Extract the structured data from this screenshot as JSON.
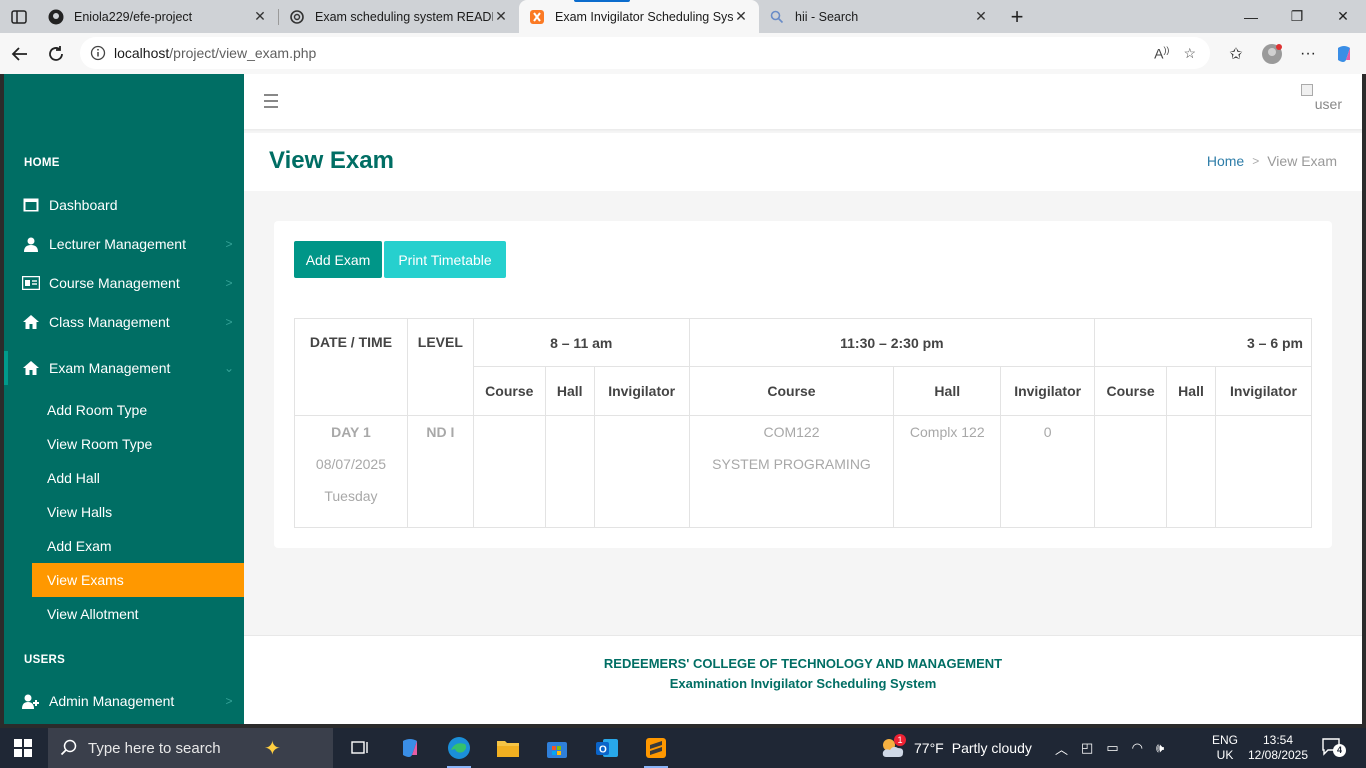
{
  "browser": {
    "tabs": [
      {
        "title": "Eniola229/efe-project",
        "icon": "github-icon"
      },
      {
        "title": "Exam scheduling system README",
        "icon": "chatgpt-icon"
      },
      {
        "title": "Exam Invigilator Scheduling Syste",
        "icon": "xampp-icon",
        "active": true
      },
      {
        "title": "hii - Search",
        "icon": "search-icon"
      }
    ],
    "url_host": "localhost",
    "url_path": "/project/view_exam.php"
  },
  "sidebar": {
    "section_home": "HOME",
    "section_users": "USERS",
    "items": [
      {
        "label": "Dashboard"
      },
      {
        "label": "Lecturer Management"
      },
      {
        "label": "Course Management"
      },
      {
        "label": "Class Management"
      },
      {
        "label": "Exam Management"
      },
      {
        "label": "Admin Management"
      }
    ],
    "subitems": [
      {
        "label": "Add Room Type"
      },
      {
        "label": "View Room Type"
      },
      {
        "label": "Add Hall"
      },
      {
        "label": "View Halls"
      },
      {
        "label": "Add Exam"
      },
      {
        "label": "View Exams"
      },
      {
        "label": "View Allotment"
      }
    ]
  },
  "header": {
    "user_alt": "user"
  },
  "page": {
    "title": "View Exam",
    "breadcrumb_home": "Home",
    "breadcrumb_current": "View Exam"
  },
  "buttons": {
    "add_exam": "Add Exam",
    "print_timetable": "Print Timetable"
  },
  "table": {
    "col_datetime": "DATE / TIME",
    "col_level": "LEVEL",
    "slots": [
      "8 – 11 am",
      "11:30 – 2:30 pm",
      "3 – 6 pm"
    ],
    "sub_course": "Course",
    "sub_hall": "Hall",
    "sub_invigilator": "Invigilator",
    "rows": [
      {
        "day": "DAY 1",
        "date": "08/07/2025",
        "weekday": "Tuesday",
        "level": "ND I",
        "slot1": {
          "course": "",
          "hall": "",
          "invigilator": ""
        },
        "slot2": {
          "course_code": "COM122",
          "course_title": "SYSTEM PROGRAMING",
          "hall": "Complx 122",
          "invigilator": "0"
        },
        "slot3": {
          "course": "",
          "hall": "",
          "invigilator": ""
        }
      }
    ]
  },
  "footer": {
    "line1": "REDEEMERS' COLLEGE OF TECHNOLOGY AND MANAGEMENT",
    "line2": "Examination Invigilator Scheduling System"
  },
  "taskbar": {
    "search_placeholder": "Type here to search",
    "temperature": "77°F",
    "weather": "Partly cloudy",
    "weather_badge": "1",
    "lang_top": "ENG",
    "lang_bottom": "UK",
    "time": "13:54",
    "date": "12/08/2025",
    "notifications": "4"
  },
  "colors": {
    "sidebar": "#006e64",
    "active_menu": "#ff9800",
    "add_button": "#009688",
    "print_button": "#26d0ce"
  }
}
